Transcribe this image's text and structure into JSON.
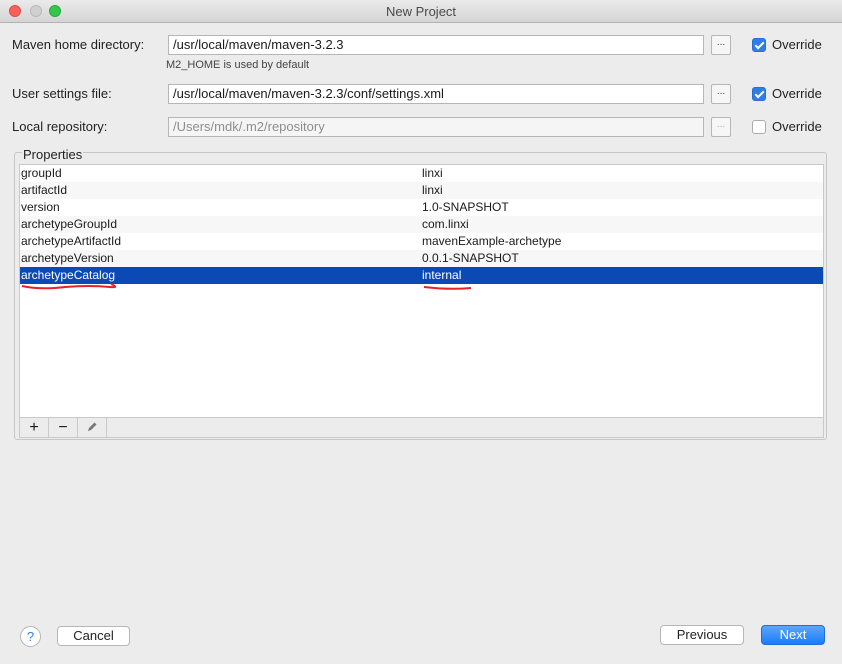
{
  "window": {
    "title": "New Project"
  },
  "maven_home": {
    "label": "Maven home directory:",
    "value": "/usr/local/maven/maven-3.2.3",
    "browse": "...",
    "override_label": "Override",
    "override_checked": true,
    "hint": "M2_HOME is used by default"
  },
  "user_settings": {
    "label": "User settings file:",
    "value": "/usr/local/maven/maven-3.2.3/conf/settings.xml",
    "browse": "...",
    "override_label": "Override",
    "override_checked": true
  },
  "local_repo": {
    "label": "Local repository:",
    "value": "/Users/mdk/.m2/repository",
    "browse": "...",
    "override_label": "Override",
    "override_checked": false
  },
  "properties": {
    "legend": "Properties",
    "rows": [
      {
        "key": "groupId",
        "value": "linxi"
      },
      {
        "key": "artifactId",
        "value": "linxi"
      },
      {
        "key": "version",
        "value": "1.0-SNAPSHOT"
      },
      {
        "key": "archetypeGroupId",
        "value": "com.linxi"
      },
      {
        "key": "archetypeArtifactId",
        "value": "mavenExample-archetype"
      },
      {
        "key": "archetypeVersion",
        "value": "0.0.1-SNAPSHOT"
      },
      {
        "key": "archetypeCatalog",
        "value": "internal"
      }
    ],
    "selected_index": 6,
    "toolbar": {
      "add": "+",
      "remove": "−"
    }
  },
  "footer": {
    "help": "?",
    "cancel": "Cancel",
    "previous": "Previous",
    "next": "Next"
  },
  "colors": {
    "selection": "#0b49b5",
    "accent": "#2f7ee8",
    "annotation": "#e8202a"
  }
}
